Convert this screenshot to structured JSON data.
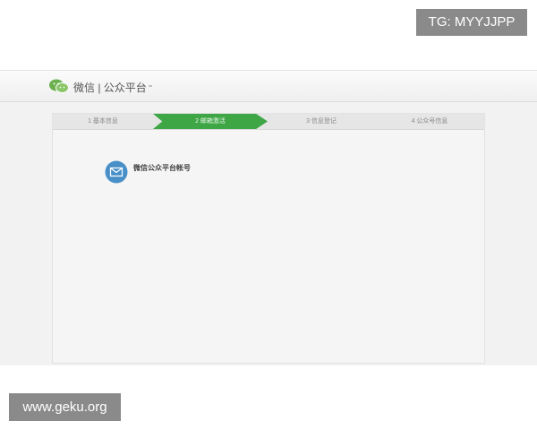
{
  "watermarks": {
    "top_right": "TG: MYYJJPP",
    "bottom_left": "www.geku.org"
  },
  "header": {
    "brand": "微信 | 公众平台",
    "brand_badge": "",
    "user_info": "",
    "logo_color": "#6ab04c"
  },
  "steps": [
    {
      "label": "1 基本信息",
      "state": "done"
    },
    {
      "label": "2 邮箱激活",
      "state": "active"
    },
    {
      "label": "3 信息登记",
      "state": "pending"
    },
    {
      "label": "4 公众号信息",
      "state": "pending"
    }
  ],
  "notice": {
    "title": "微信公众平台帐号",
    "text": ""
  },
  "help": {
    "title": "",
    "items": [
      "",
      "",
      ""
    ]
  },
  "colors": {
    "accent_green": "#3ea645",
    "mail_icon_blue": "#4a90c8"
  }
}
